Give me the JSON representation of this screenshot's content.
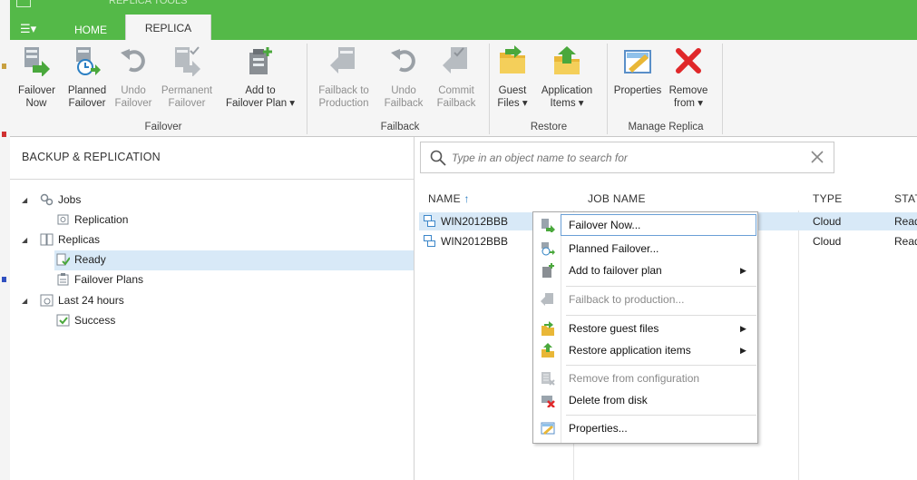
{
  "window": {
    "tools_title": "REPLICA TOOLS",
    "menu_label": "☰▾",
    "tabs": [
      {
        "label": "HOME"
      },
      {
        "label": "REPLICA"
      }
    ]
  },
  "ribbon": {
    "groups": [
      {
        "label": "Failover",
        "buttons": [
          {
            "line1": "Failover",
            "line2": "Now",
            "icon": "failover-now-icon",
            "enabled": true
          },
          {
            "line1": "Planned",
            "line2": "Failover",
            "icon": "planned-failover-icon",
            "enabled": true
          },
          {
            "line1": "Undo",
            "line2": "Failover",
            "icon": "undo-failover-icon",
            "enabled": false
          },
          {
            "line1": "Permanent",
            "line2": "Failover",
            "icon": "permanent-failover-icon",
            "enabled": false
          },
          {
            "line1": "Add to",
            "line2": "Failover Plan ▾",
            "icon": "add-to-failover-plan-icon",
            "enabled": true
          }
        ]
      },
      {
        "label": "Failback",
        "buttons": [
          {
            "line1": "Failback to",
            "line2": "Production",
            "icon": "failback-icon",
            "enabled": false
          },
          {
            "line1": "Undo",
            "line2": "Failback",
            "icon": "undo-failback-icon",
            "enabled": false
          },
          {
            "line1": "Commit",
            "line2": "Failback",
            "icon": "commit-failback-icon",
            "enabled": false
          }
        ]
      },
      {
        "label": "Restore",
        "buttons": [
          {
            "line1": "Guest",
            "line2": "Files ▾",
            "icon": "guest-files-icon",
            "enabled": true
          },
          {
            "line1": "Application",
            "line2": "Items ▾",
            "icon": "application-items-icon",
            "enabled": true
          }
        ]
      },
      {
        "label": "Manage Replica",
        "buttons": [
          {
            "line1": "Properties",
            "line2": "",
            "icon": "properties-icon",
            "enabled": true
          },
          {
            "line1": "Remove",
            "line2": "from ▾",
            "icon": "remove-icon",
            "enabled": true
          }
        ]
      }
    ]
  },
  "left_pane": {
    "title": "BACKUP & REPLICATION",
    "tree": [
      {
        "label": "Jobs",
        "icon": "jobs-icon",
        "expander": "◢"
      },
      {
        "label": "Replication",
        "icon": "replication-job-icon"
      },
      {
        "label": "Replicas",
        "icon": "replicas-icon",
        "expander": "◢"
      },
      {
        "label": "Ready",
        "icon": "ready-icon",
        "selected": true
      },
      {
        "label": "Failover Plans",
        "icon": "failover-plans-icon"
      },
      {
        "label": "Last 24 hours",
        "icon": "last-24-hours-icon",
        "expander": "◢"
      },
      {
        "label": "Success",
        "icon": "success-icon"
      }
    ]
  },
  "search": {
    "placeholder": "Type in an object name to search for"
  },
  "table": {
    "columns": [
      {
        "label": "NAME",
        "sort": "↑"
      },
      {
        "label": "JOB NAME"
      },
      {
        "label": "TYPE"
      },
      {
        "label": "STAT"
      }
    ],
    "rows": [
      {
        "name": "WIN2012BBB",
        "type": "Cloud",
        "status": "Read",
        "selected": true
      },
      {
        "name": "WIN2012BBB",
        "type": "Cloud",
        "status": "Read",
        "selected": false
      }
    ]
  },
  "context_menu": {
    "items": [
      {
        "label": "Failover Now...",
        "icon": "failover-now-icon",
        "enabled": true
      },
      {
        "label": "Planned Failover...",
        "icon": "planned-failover-icon",
        "enabled": true
      },
      {
        "label": "Add to failover plan",
        "icon": "add-to-plan-icon",
        "enabled": true,
        "submenu": "▶"
      },
      {
        "label": "Failback to production...",
        "icon": "failback-icon",
        "enabled": false
      },
      {
        "label": "Restore guest files",
        "icon": "restore-guest-files-icon",
        "enabled": true,
        "submenu": "▶"
      },
      {
        "label": "Restore application items",
        "icon": "restore-app-items-icon",
        "enabled": true,
        "submenu": "▶"
      },
      {
        "label": "Remove from configuration",
        "icon": "remove-config-icon",
        "enabled": false
      },
      {
        "label": "Delete from disk",
        "icon": "delete-disk-icon",
        "enabled": true
      },
      {
        "label": "Properties...",
        "icon": "properties-icon",
        "enabled": true
      }
    ]
  },
  "colors": {
    "accent": "#54b948",
    "selection": "#d8e9f7",
    "highlight_border": "#6a9fd6",
    "remove_red": "#e0282a"
  }
}
